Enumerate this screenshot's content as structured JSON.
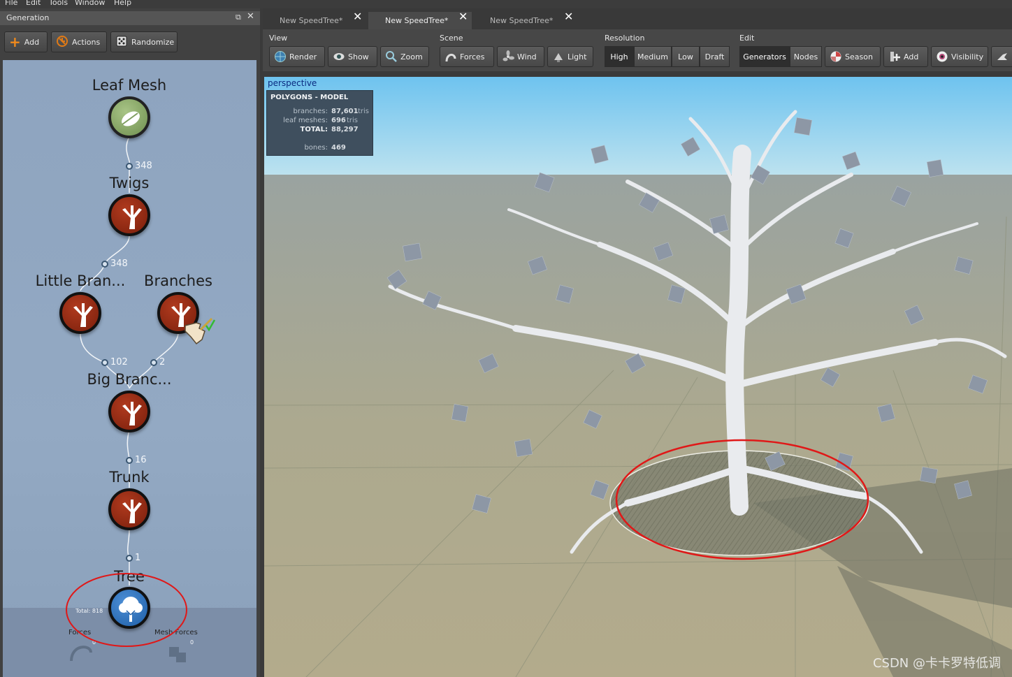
{
  "menu": [
    "File",
    "Edit",
    "Tools",
    "Window",
    "Help"
  ],
  "generation_panel": {
    "title": "Generation",
    "buttons": {
      "add": "Add",
      "actions": "Actions",
      "randomize": "Randomize"
    },
    "nodes": {
      "leaf_mesh": "Leaf Mesh",
      "twigs": "Twigs",
      "little_branches": "Little Bran...",
      "branches": "Branches",
      "big_branches": "Big Branc...",
      "trunk": "Trunk",
      "tree": "Tree"
    },
    "counts": {
      "twigs": "348",
      "little": "348",
      "big_a": "102",
      "big_b": "2",
      "trunk": "16",
      "tree": "1"
    },
    "tree_total": "Total: 818",
    "bottom": {
      "forces": "Forces",
      "forces_count": "0",
      "mesh_forces": "Mesh Forces",
      "mesh_forces_count": "0"
    }
  },
  "tabs": [
    "New SpeedTree*",
    "New SpeedTree*",
    "New SpeedTree*"
  ],
  "ribbon": {
    "groups": {
      "view": "View",
      "scene": "Scene",
      "resolution": "Resolution",
      "edit": "Edit"
    },
    "view": [
      "Render",
      "Show",
      "Zoom"
    ],
    "scene": [
      "Forces",
      "Wind",
      "Light"
    ],
    "resolution": [
      "High",
      "Medium",
      "Low",
      "Draft"
    ],
    "edit_tabs": [
      "Generators",
      "Nodes"
    ],
    "edit": [
      "Season",
      "Add",
      "Visibility"
    ]
  },
  "viewport": {
    "mode": "perspective",
    "stats": {
      "header": "POLYGONS - MODEL",
      "branches_label": "branches:",
      "branches_value": "87,601",
      "branches_unit": "tris",
      "leaf_label": "leaf meshes:",
      "leaf_value": "696",
      "leaf_unit": "tris",
      "total_label": "TOTAL:",
      "total_value": "88,297",
      "bones_label": "bones:",
      "bones_value": "469"
    }
  },
  "watermark": "CSDN @卡卡罗特低调"
}
